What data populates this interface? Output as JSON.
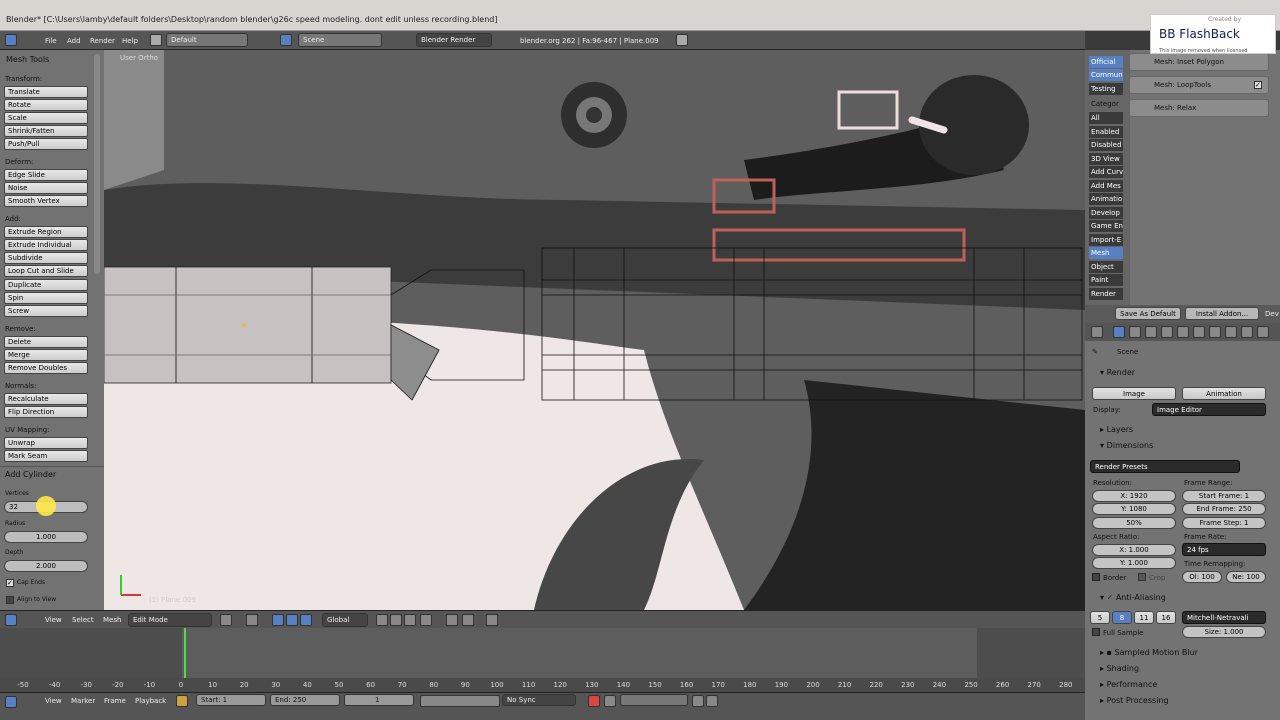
{
  "window": {
    "title": "Blender* [C:\\Users\\lamby\\default folders\\Desktop\\random blender\\g26c speed modeling. dont edit unless recording.blend]"
  },
  "watermark": {
    "created_by": "Created by",
    "name": "BB FlashBack",
    "removed": "This image removed when licensed"
  },
  "info_header": {
    "menus": [
      "File",
      "Add",
      "Render",
      "Help"
    ],
    "layout": "Default",
    "scene": "Scene",
    "engine": "Blender Render",
    "stats": "blender.org 262 | Fa:96-467 | Plane.009"
  },
  "tool_panel": {
    "title": "Mesh Tools",
    "sections": [
      {
        "label": "Transform:",
        "buttons": [
          "Translate",
          "Rotate",
          "Scale",
          "Shrink/Fatten",
          "Push/Pull"
        ]
      },
      {
        "label": "Deform:",
        "buttons": [
          "Edge Slide",
          "Noise",
          "Smooth Vertex"
        ]
      },
      {
        "label": "Add:",
        "buttons": [
          "Extrude Region",
          "Extrude Individual",
          "Subdivide",
          "Loop Cut and Slide",
          "Duplicate",
          "Spin",
          "Screw"
        ]
      },
      {
        "label": "Remove:",
        "buttons": [
          "Delete",
          "Merge",
          "Remove Doubles"
        ]
      },
      {
        "label": "Normals:",
        "buttons": [
          "Recalculate",
          "Flip Direction"
        ]
      },
      {
        "label": "UV Mapping:",
        "buttons": [
          "Unwrap",
          "Mark Seam"
        ]
      }
    ],
    "operator": {
      "title": "Add Cylinder",
      "vertices_label": "Vertices",
      "vertices_value": "32",
      "radius_label": "Radius",
      "radius_value": "1.000",
      "depth_label": "Depth",
      "depth_value": "2.000",
      "cap_ends": "Cap Ends",
      "align_to_view": "Align to View"
    }
  },
  "viewport": {
    "view_label": "User Ortho",
    "object_label": "(1) Plane.009"
  },
  "viewport_header": {
    "menus": [
      "View",
      "Select",
      "Mesh"
    ],
    "mode": "Edit Mode",
    "orientation": "Global"
  },
  "timeline": {
    "ticks": [
      "-50",
      "-40",
      "-30",
      "-20",
      "-10",
      "0",
      "10",
      "20",
      "30",
      "40",
      "50",
      "60",
      "70",
      "80",
      "90",
      "100",
      "110",
      "120",
      "130",
      "140",
      "150",
      "160",
      "170",
      "180",
      "190",
      "200",
      "210",
      "220",
      "230",
      "240",
      "250",
      "260",
      "270",
      "280"
    ],
    "current_frame_value": 1,
    "menus": [
      "View",
      "Marker",
      "Frame",
      "Playback"
    ],
    "start": "Start: 1",
    "end": "End: 250",
    "current": "1",
    "sync": "No Sync"
  },
  "addons": {
    "support": [
      "Official",
      "Commun",
      "Testing"
    ],
    "category_label": "Categor",
    "categories": [
      "All",
      "Enabled",
      "Disabled",
      "3D View",
      "Add Curv",
      "Add Mes",
      "Animatio",
      "Develop",
      "Game En",
      "Import-E",
      "Mesh",
      "Object",
      "Paint",
      "Render"
    ],
    "active_category": "Mesh",
    "items": [
      "Mesh: Inset Polygon",
      "Mesh: LoopTools",
      "Mesh: Relax"
    ],
    "save_default": "Save As Default",
    "install": "Install Addon...",
    "dev": "Dev"
  },
  "properties": {
    "scene_label": "Scene",
    "render": {
      "title": "Render",
      "image_btn": "Image",
      "animation_btn": "Animation",
      "display_label": "Display:",
      "display_value": "Image Editor"
    },
    "layers": "Layers",
    "dimensions": {
      "title": "Dimensions",
      "presets": "Render Presets",
      "resolution_label": "Resolution:",
      "res_x": "X: 1920",
      "res_y": "Y: 1080",
      "res_pct": "50%",
      "frame_range_label": "Frame Range:",
      "start_frame": "Start Frame: 1",
      "end_frame": "End Frame: 250",
      "frame_step": "Frame Step: 1",
      "aspect_label": "Aspect Ratio:",
      "asp_x": "X: 1.000",
      "asp_y": "Y: 1.000",
      "frame_rate_label": "Frame Rate:",
      "frame_rate": "24 fps",
      "remap_label": "Time Remapping:",
      "remap_old": "Ol: 100",
      "remap_new": "Ne: 100",
      "border": "Border",
      "crop": "Crop"
    },
    "anti_aliasing": {
      "title": "Anti-Aliasing",
      "samples": [
        "5",
        "8",
        "11",
        "16"
      ],
      "active_sample": "8",
      "filter": "Mitchell-Netravali",
      "full_sample": "Full Sample",
      "size": "Size: 1.000"
    },
    "sampled_motion_blur": "Sampled Motion Blur",
    "shading": "Shading",
    "performance": "Performance",
    "post_processing": "Post Processing"
  },
  "colors": {
    "accent_blue": "#5680c2",
    "cursor_yellow": "#ffe84a",
    "frame_green": "#4bdc4b"
  }
}
